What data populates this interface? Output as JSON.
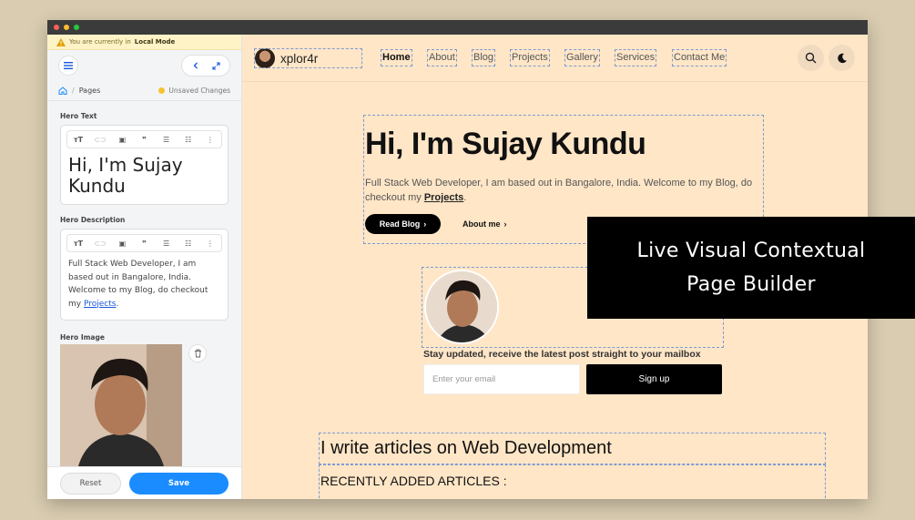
{
  "sidebar": {
    "local_mode_prefix": "You are currently in",
    "local_mode_strong": "Local Mode",
    "breadcrumb_page": "Pages",
    "unsaved": "Unsaved Changes",
    "hero_text_label": "Hero Text",
    "hero_text_value": "Hi, I'm Sujay Kundu",
    "hero_desc_label": "Hero Description",
    "hero_desc_value": "Full Stack Web Developer, I am based out in Bangalore, India. Welcome to my Blog, do checkout my",
    "hero_desc_link": "Projects",
    "hero_image_label": "Hero Image",
    "reset_label": "Reset",
    "save_label": "Save"
  },
  "preview": {
    "brand": "xplor4r",
    "nav": [
      "Home",
      "About",
      "Blog",
      "Projects",
      "Gallery",
      "Services",
      "Contact Me"
    ],
    "hero_title": "Hi, I'm Sujay Kundu",
    "hero_desc": "Full Stack Web Developer, I am based out in Bangalore, India. Welcome to my Blog, do checkout my",
    "hero_link": "Projects",
    "read_blog": "Read Blog",
    "about_me": "About me",
    "subscribe_text": "Stay updated, receive the latest post straight to your mailbox",
    "email_placeholder": "Enter your email",
    "signup": "Sign up",
    "articles_heading": "I write articles on Web Development",
    "recent_heading": "RECENTLY ADDED ARTICLES :"
  },
  "overlay": {
    "line1": "Live Visual Contextual",
    "line2": "Page Builder"
  },
  "colors": {
    "preview_bg": "#ffe6c7",
    "save_button": "#1a8cff",
    "local_mode_banner": "#fdf3c6"
  }
}
